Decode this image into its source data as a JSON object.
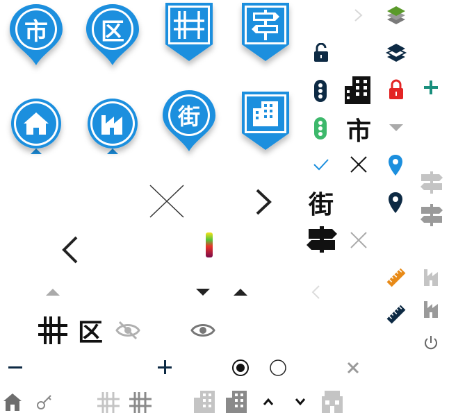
{
  "colors": {
    "pin_blue": "#1c8fde",
    "dark_navy": "#0d2a44",
    "teal": "#1a8f7d",
    "green": "#3db86b",
    "red": "#e32424",
    "orange": "#e88a17",
    "gray": "#9a9a9a",
    "light_gray": "#c4c4c4",
    "black": "#111111"
  },
  "pins": {
    "city": "市",
    "ward": "区",
    "town": "街"
  },
  "glyphs": {
    "city_black": "市",
    "town_black": "街",
    "ward_black": "区"
  }
}
